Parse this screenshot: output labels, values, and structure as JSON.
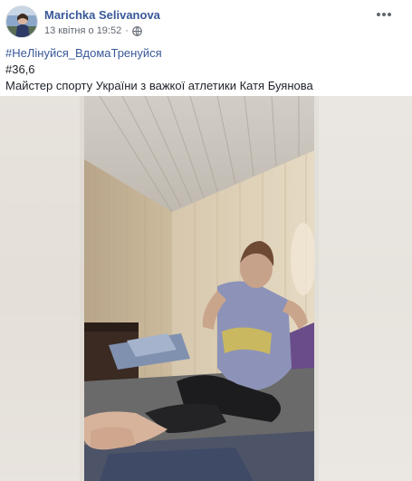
{
  "post": {
    "author": "Marichka Selivanova",
    "timestamp": "13 квітня о 19:52",
    "hashtag": "#НеЛінуйся_ВдомаТренуйся",
    "line2": "#36,6",
    "line3": "Майстер спорту України з важкої атлетики Катя Буянова",
    "icons": {
      "privacy": "globe-icon",
      "menu": "ellipsis-icon"
    }
  },
  "colors": {
    "link": "#385898",
    "text": "#1d2129",
    "meta": "#616770"
  }
}
